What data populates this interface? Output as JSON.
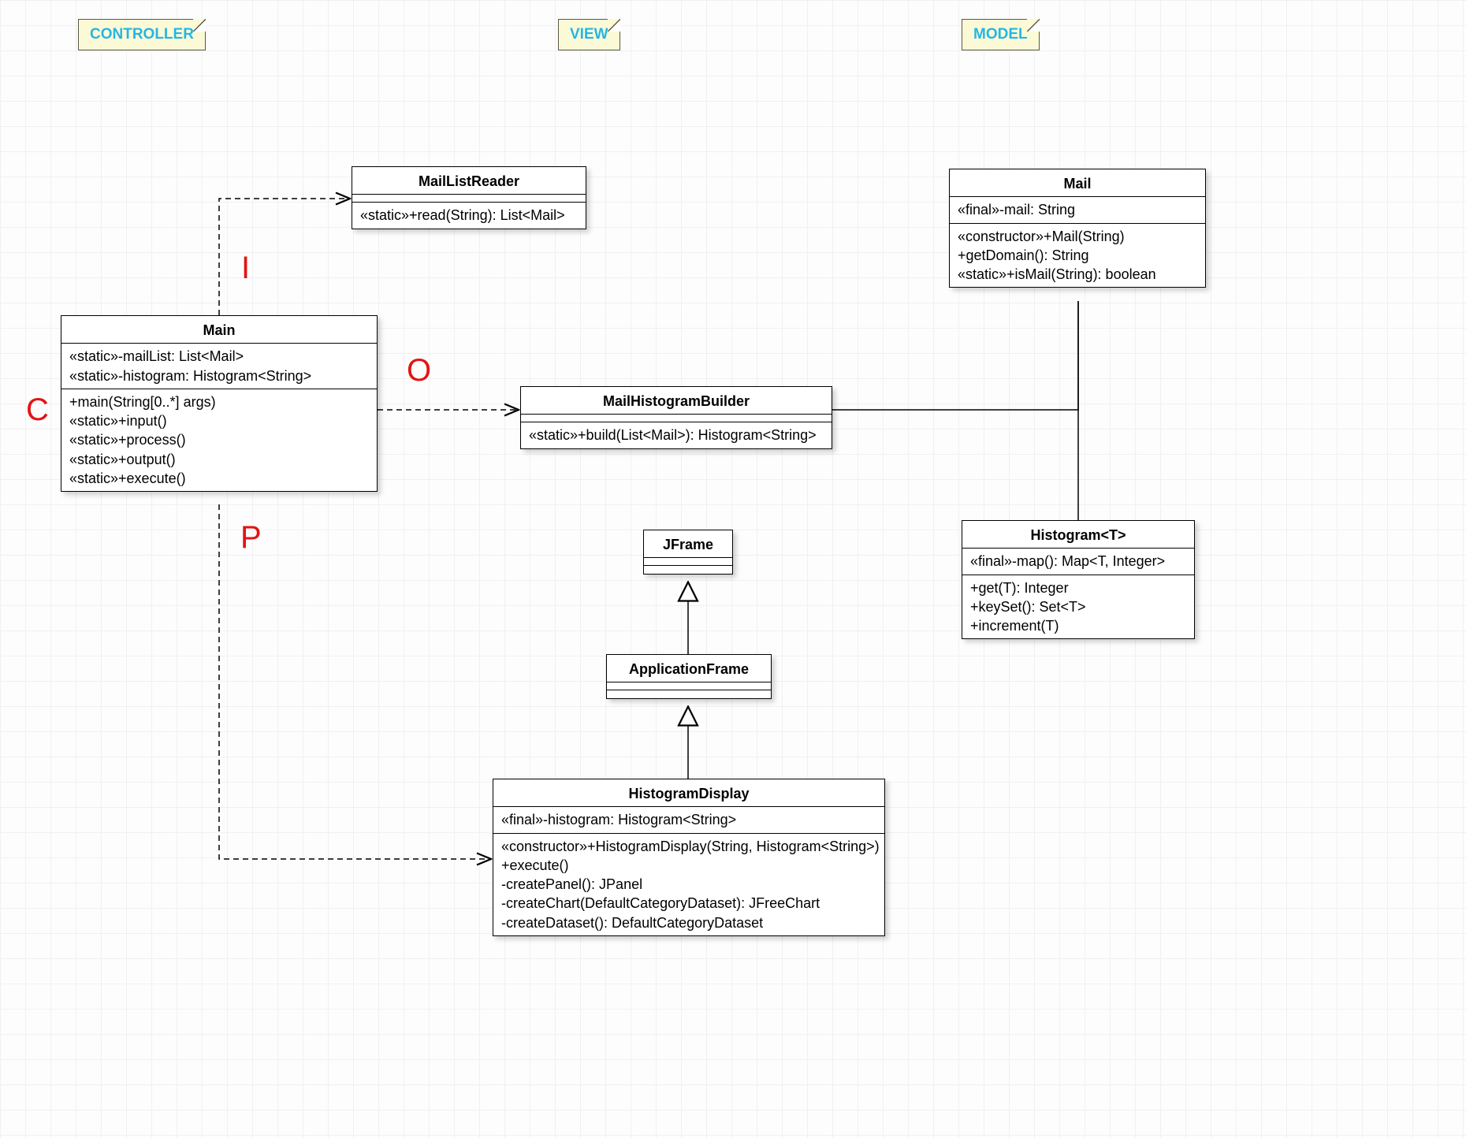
{
  "notes": {
    "controller": "CONTROLLER",
    "view": "VIEW",
    "model": "MODEL"
  },
  "annotations": {
    "C": "C",
    "I": "I",
    "O": "O",
    "P": "P"
  },
  "classes": {
    "Main": {
      "name": "Main",
      "attrs": [
        "«static»-mailList: List<Mail>",
        "«static»-histogram: Histogram<String>"
      ],
      "ops": [
        "+main(String[0..*] args)",
        "«static»+input()",
        "«static»+process()",
        "«static»+output()",
        "«static»+execute()"
      ]
    },
    "MailListReader": {
      "name": "MailListReader",
      "attrs": [],
      "ops": [
        "«static»+read(String): List<Mail>"
      ]
    },
    "MailHistogramBuilder": {
      "name": "MailHistogramBuilder",
      "attrs": [],
      "ops": [
        "«static»+build(List<Mail>): Histogram<String>"
      ]
    },
    "JFrame": {
      "name": "JFrame",
      "attrs": [],
      "ops": []
    },
    "ApplicationFrame": {
      "name": "ApplicationFrame",
      "attrs": [],
      "ops": []
    },
    "HistogramDisplay": {
      "name": "HistogramDisplay",
      "attrs": [
        "«final»-histogram: Histogram<String>"
      ],
      "ops": [
        "«constructor»+HistogramDisplay(String, Histogram<String>)",
        "+execute()",
        "-createPanel(): JPanel",
        "-createChart(DefaultCategoryDataset): JFreeChart",
        "-createDataset(): DefaultCategoryDataset"
      ]
    },
    "Mail": {
      "name": "Mail",
      "attrs": [
        "«final»-mail: String"
      ],
      "ops": [
        "«constructor»+Mail(String)",
        "+getDomain(): String",
        "«static»+isMail(String): boolean"
      ]
    },
    "Histogram": {
      "name": "Histogram<T>",
      "attrs": [
        "«final»-map(): Map<T, Integer>"
      ],
      "ops": [
        "+get(T): Integer",
        "+keySet(): Set<T>",
        "+increment(T)"
      ]
    }
  }
}
